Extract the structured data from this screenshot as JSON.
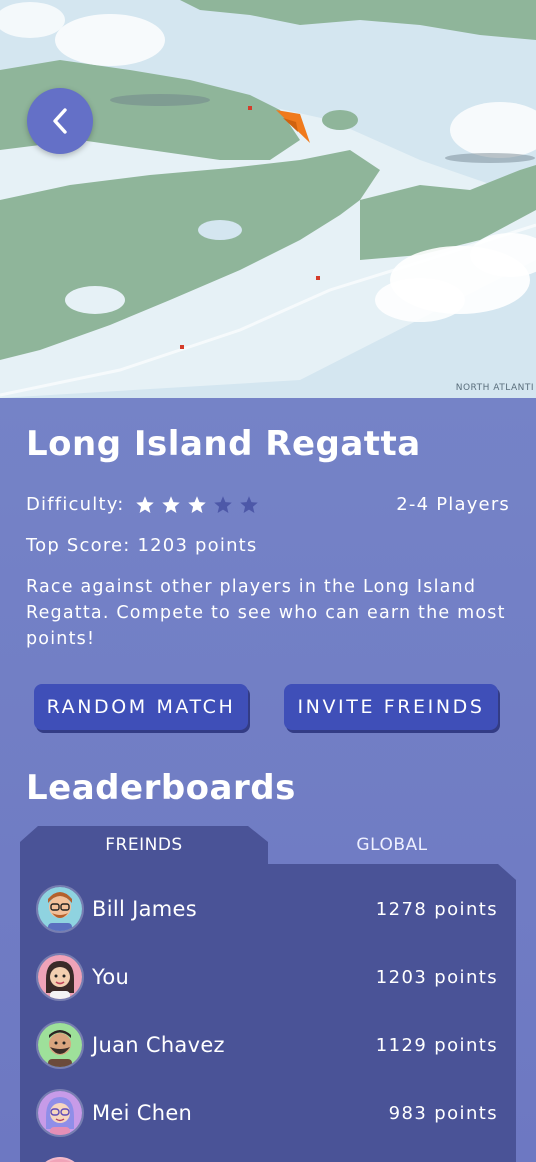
{
  "map": {
    "caption": "NORTH ATLANTI",
    "back_icon": "chevron-left-icon",
    "colors": {
      "water": "#cfe3ee",
      "land": "#8fb59a",
      "boat": "#f07a1c"
    }
  },
  "game": {
    "title": "Long Island Regatta",
    "difficulty_label": "Difficulty:",
    "difficulty_rating": 3,
    "difficulty_max": 5,
    "players": "2-4 Players",
    "top_score": "Top Score: 1203 points",
    "description": "Race against other players in the Long Island Regatta. Compete to see who can earn the most points!"
  },
  "buttons": {
    "random_match": "RANDOM MATCH",
    "invite_friends": "INVITE FREINDS"
  },
  "leaderboards": {
    "title": "Leaderboards",
    "tabs": [
      {
        "label": "FREINDS",
        "active": true
      },
      {
        "label": "GLOBAL",
        "active": false
      }
    ],
    "entries": [
      {
        "name": "Bill James",
        "points": "1278 points",
        "avatar_bg": "#8fd3e0"
      },
      {
        "name": "You",
        "points": "1203 points",
        "avatar_bg": "#f0a3b8"
      },
      {
        "name": "Juan Chavez",
        "points": "1129 points",
        "avatar_bg": "#9ee09a"
      },
      {
        "name": "Mei Chen",
        "points": "983 points",
        "avatar_bg": "#c79be8"
      }
    ]
  },
  "colors": {
    "accent": "#3f4fb8",
    "panel": "#4a5397",
    "background": "#6f7cc4",
    "star_filled": "#ffffff",
    "star_empty": "#4d58a8"
  }
}
